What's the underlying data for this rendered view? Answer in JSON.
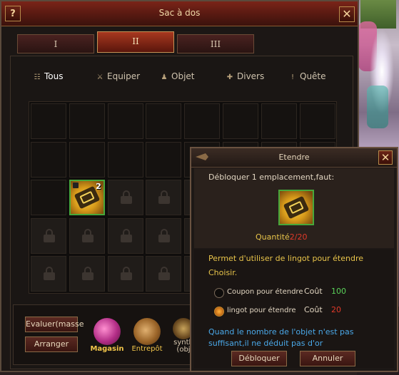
{
  "window": {
    "title": "Sac à dos",
    "help_label": "?",
    "close_label": "✕"
  },
  "tabs": [
    {
      "label": "I",
      "active": false
    },
    {
      "label": "II",
      "active": true
    },
    {
      "label": "III",
      "active": false
    }
  ],
  "categories": [
    {
      "label": "Tous",
      "icon": "list-icon",
      "glyph": "☷",
      "active": true
    },
    {
      "label": "Equiper",
      "icon": "sword-icon",
      "glyph": "⚔",
      "active": false
    },
    {
      "label": "Objet",
      "icon": "flask-icon",
      "glyph": "♟",
      "active": false
    },
    {
      "label": "Divers",
      "icon": "cross-icon",
      "glyph": "✚",
      "active": false
    },
    {
      "label": "Quête",
      "icon": "exclamation-icon",
      "glyph": "!",
      "active": false
    }
  ],
  "grid": {
    "item": {
      "name": "scroll-item",
      "count": "2"
    }
  },
  "bottom": {
    "evaluate_label": "Evaluer(masse",
    "arrange_label": "Arranger",
    "magasin_label": "Magasin",
    "entrepot_label": "Entrepôt",
    "synth_label_1": "synth",
    "synth_label_2": "(obj"
  },
  "dialog": {
    "title": "Etendre",
    "close_label": "✕",
    "unlock_text": "Débloquer 1 emplacement,faut:",
    "quantity_label": "Quantité",
    "quantity_value": "2/20",
    "permit_text": "Permet d'utiliser de lingot pour étendre",
    "choose_label": "Choisir.",
    "option_coupon": "Coupon pour étendre",
    "option_lingot": "lingot pour étendre",
    "cost_label": "Coût",
    "cost_coupon": "100",
    "cost_lingot": "20",
    "warning": "Quand le nombre de l'objet n'est pas suffisant,il ne déduit pas d'or",
    "unlock_button": "Débloquer",
    "cancel_button": "Annuler"
  },
  "colors": {
    "accent_red": "#a8381f",
    "green_value": "#5ad25a",
    "red_value": "#e23a2a",
    "blue_text": "#4aa8e8"
  }
}
